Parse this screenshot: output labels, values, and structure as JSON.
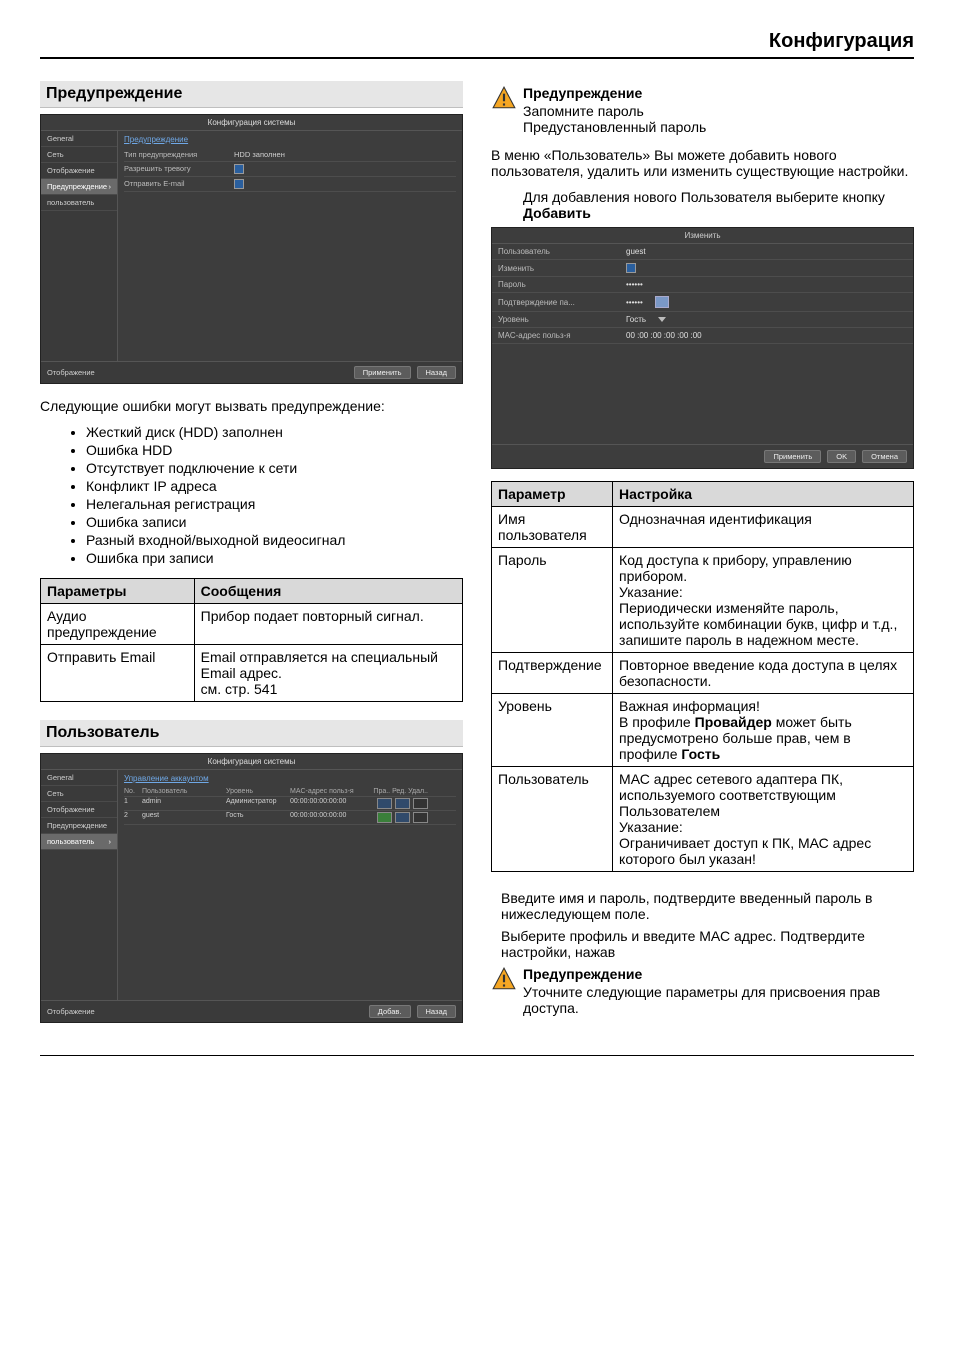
{
  "page_title": "Конфигурация",
  "left": {
    "section1_title": "Предупреждение",
    "screenshot1": {
      "title": "Конфигурация системы",
      "sidebar": [
        "General",
        "Сеть",
        "Отображение",
        "Предупреждение",
        "пользователь"
      ],
      "sidebar_active_idx": 3,
      "tab": "Предупреждение",
      "rows": [
        {
          "k": "Тип предупреждения",
          "v": "HDD заполнен"
        },
        {
          "k": "Разрешить тревогу",
          "v": "[x]"
        },
        {
          "k": "Отправить E-mail",
          "v": "[x]"
        }
      ],
      "footer_left": "Отображение",
      "buttons": [
        "Применить",
        "Назад"
      ]
    },
    "errors_intro": "Следующие ошибки могут вызвать предупреждение:",
    "error_list": [
      "Жесткий диск (HDD) заполнен",
      "Ошибка HDD",
      "Отсутствует подключение к сети",
      "Конфликт IP адреса",
      "Нелегальная регистрация",
      "Ошибка записи",
      "Разный входной/выходной видеосигнал",
      "Ошибка при записи"
    ],
    "table1": {
      "h1": "Параметры",
      "h2": "Сообщения",
      "rows": [
        {
          "p": "Аудио предупреждение",
          "m": "Прибор подает повторный сигнал."
        },
        {
          "p": "Отправить Email",
          "m": "Email отправляется на специальный Email адрес.\nсм. стр. 541"
        }
      ]
    },
    "section2_title": "Пользователь",
    "screenshot2": {
      "title": "Конфигурация системы",
      "sidebar": [
        "General",
        "Сеть",
        "Отображение",
        "Предупреждение",
        "пользователь"
      ],
      "sidebar_active_idx": 4,
      "tab": "Управление аккаунтом",
      "head": {
        "no": "No.",
        "user": "Пользователь",
        "lvl": "Уровень",
        "mac": "MAC-адрес польз-я",
        "act": "Пра.. Ред. Удал.."
      },
      "rows": [
        {
          "no": "1",
          "user": "admin",
          "lvl": "Администратор",
          "mac": "00:00:00:00:00:00",
          "acts": [
            "b",
            "b",
            "x"
          ]
        },
        {
          "no": "2",
          "user": "guest",
          "lvl": "Гость",
          "mac": "00:00:00:00:00:00",
          "acts": [
            "g",
            "b",
            "x"
          ]
        }
      ],
      "footer_left": "Отображение",
      "buttons": [
        "Добав.",
        "Назад"
      ]
    }
  },
  "right": {
    "warn1_title": "Предупреждение",
    "warn1_l1": "Запомните пароль",
    "warn1_l2": "Предустановленный пароль",
    "user_menu_para": "В меню «Пользователь» Вы можете добавить нового пользователя, удалить или изменить существующие настройки.",
    "add_para_pre": "Для добавления нового Пользователя выберите кнопку ",
    "add_para_bold": "Добавить",
    "dialog": {
      "title": "Изменить",
      "rows": [
        {
          "k": "Пользователь",
          "v": "guest"
        },
        {
          "k": "Изменить",
          "chk": true
        },
        {
          "k": "Пароль",
          "v": "••••••"
        },
        {
          "k": "Подтверждение па...",
          "v": "••••••",
          "kb": true
        },
        {
          "k": "Уровень",
          "v": "Гость",
          "dd": true
        },
        {
          "k": "МАС-адрес польз-я",
          "v": "00 :00 :00 :00 :00 :00"
        }
      ],
      "buttons": [
        "Применить",
        "OK",
        "Отмена"
      ]
    },
    "table2": {
      "h1": "Параметр",
      "h2": "Настройка",
      "rows": [
        {
          "p": "Имя пользователя",
          "m": "Однозначная идентификация"
        },
        {
          "p": "Пароль",
          "m_html": "Код доступа к прибору, управлению прибором.<br>Указание:<br>Периодически изменяйте пароль, используйте комбинации букв, цифр и т.д., запишите пароль в надежном месте."
        },
        {
          "p": "Подтверждение",
          "m": "Повторное введение кода доступа в целях безопасности."
        },
        {
          "p": "Уровень",
          "m_html": "Важная информация!<br>В профиле <b>Провайдер</b> может быть предусмотрено больше прав, чем в профиле <b>Гость</b>"
        },
        {
          "p": "Пользователь",
          "m_html": "МАС адрес сетевого адаптера ПК, используемого соответствующим Пользователем<br>Указание:<br>Ограничивает доступ к ПК, МАС адрес которого был указан!"
        }
      ]
    },
    "after1": "Введите имя и пароль, подтвердите введенный пароль в нижеследующем поле.",
    "after2": "Выберите профиль и введите МАС адрес. Подтвердите настройки, нажав",
    "warn2_title": "Предупреждение",
    "warn2_body": "Уточните следующие параметры для присвоения прав доступа."
  }
}
